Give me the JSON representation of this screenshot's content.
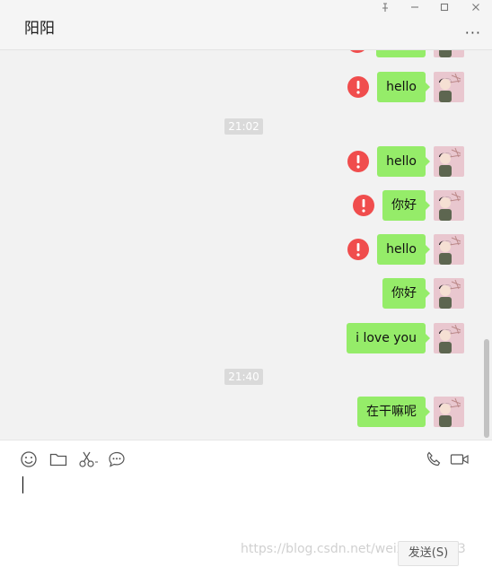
{
  "window": {
    "title": "阳阳",
    "more_label": "···"
  },
  "messages": [
    {
      "type": "msg",
      "text": "hello",
      "failed": true
    },
    {
      "type": "time",
      "text": "21:02"
    },
    {
      "type": "msg",
      "text": "hello",
      "failed": true
    },
    {
      "type": "msg",
      "text": "你好",
      "failed": true
    },
    {
      "type": "msg",
      "text": "hello",
      "failed": true
    },
    {
      "type": "msg",
      "text": "你好",
      "failed": false
    },
    {
      "type": "msg",
      "text": "i love you",
      "failed": false
    },
    {
      "type": "time",
      "text": "21:40"
    },
    {
      "type": "msg",
      "text": "在干嘛呢",
      "failed": false
    }
  ],
  "composer": {
    "send_label": "发送(S)",
    "watermark": "https://blog.csdn.net/weixin_44 263"
  },
  "colors": {
    "bubble": "#95ec69",
    "error": "#f04d4d"
  }
}
